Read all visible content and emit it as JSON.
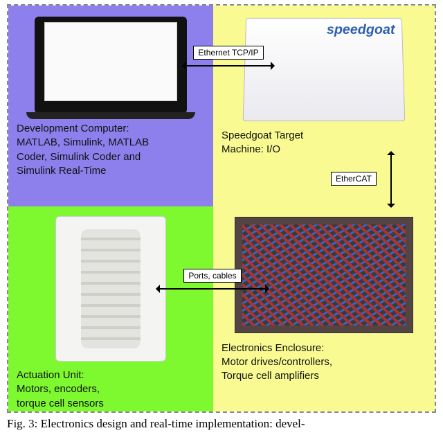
{
  "panels": {
    "dev": {
      "title": "Development Computer:",
      "lines": [
        "MATLAB, Simulink, MATLAB",
        "Coder, Simulink Coder and",
        "Simulink Real-Time"
      ]
    },
    "target": {
      "title": "Speedgoat Target",
      "lines": [
        "Machine: I/O"
      ]
    },
    "actuation": {
      "title": "Actuation Unit:",
      "lines": [
        "Motors, encoders,",
        "torque cell sensors"
      ]
    },
    "enclosure": {
      "title": "Electronics Enclosure:",
      "lines": [
        "Motor drives/controllers,",
        "Torque cell amplifiers"
      ]
    }
  },
  "arrows": {
    "top": "Ethernet TCP/IP",
    "right": "EtherCAT",
    "mid": "Ports, cables"
  },
  "caption": "Fig. 3: Electronics design and real-time implementation: devel-"
}
